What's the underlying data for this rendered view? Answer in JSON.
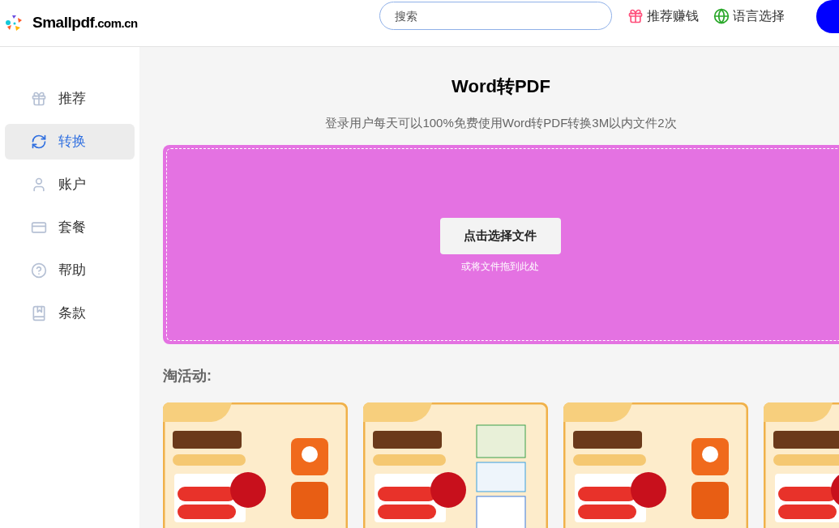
{
  "header": {
    "logo": "Smallpdf",
    "logo_suffix": ".com.cn",
    "search": {
      "placeholder": "搜索"
    },
    "links": [
      {
        "kind": "gift",
        "label": "推荐赚钱"
      },
      {
        "kind": "globe",
        "label": "语言选择"
      }
    ]
  },
  "sidebar": {
    "items": [
      {
        "kind": "gift",
        "label": "推荐",
        "selected": false
      },
      {
        "kind": "convert",
        "label": "转换",
        "selected": true
      },
      {
        "kind": "user",
        "label": "账户",
        "selected": false
      },
      {
        "kind": "card",
        "label": "套餐",
        "selected": false
      },
      {
        "kind": "help",
        "label": "帮助",
        "selected": false
      },
      {
        "kind": "terms",
        "label": "条款",
        "selected": false
      }
    ]
  },
  "main": {
    "title": "Word转PDF",
    "subtitle": "登录用户每天可以100%免费使用Word转PDF转换3M以内文件2次",
    "upload": {
      "button": "点击选择文件",
      "hint": "或将文件拖到此处"
    },
    "promotions": {
      "heading": "淘活动:"
    }
  }
}
